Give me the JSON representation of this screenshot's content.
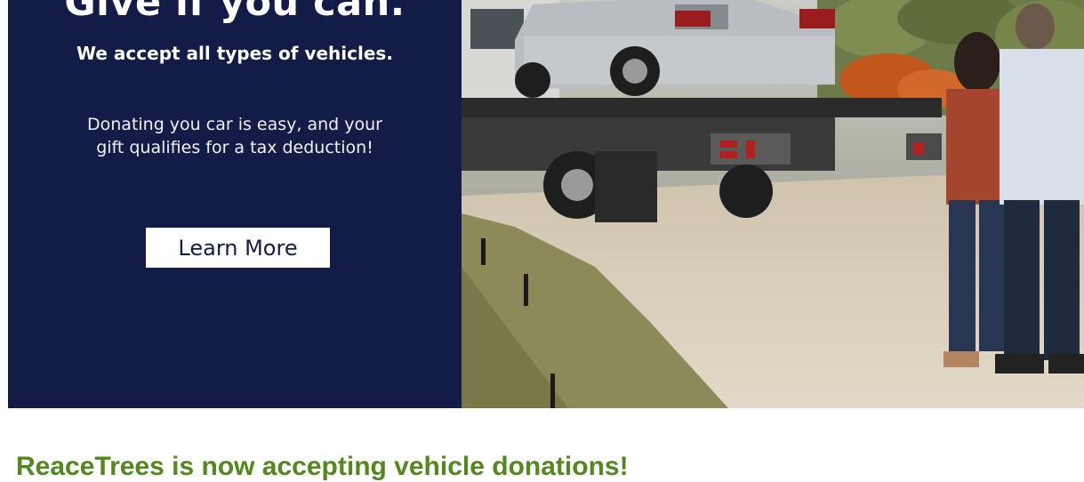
{
  "banner": {
    "headline": "Give if you can.",
    "subhead": "We accept all types of vehicles.",
    "body": "Donating you car is easy, and your gift qualifies for a tax deduction!",
    "cta_label": "Learn More",
    "panel_color": "#121c47"
  },
  "photo": {
    "description_icon": "tow-truck-photo"
  },
  "section": {
    "heading": "ReaceTrees is now accepting vehicle donations!",
    "heading_color": "#52891e"
  }
}
